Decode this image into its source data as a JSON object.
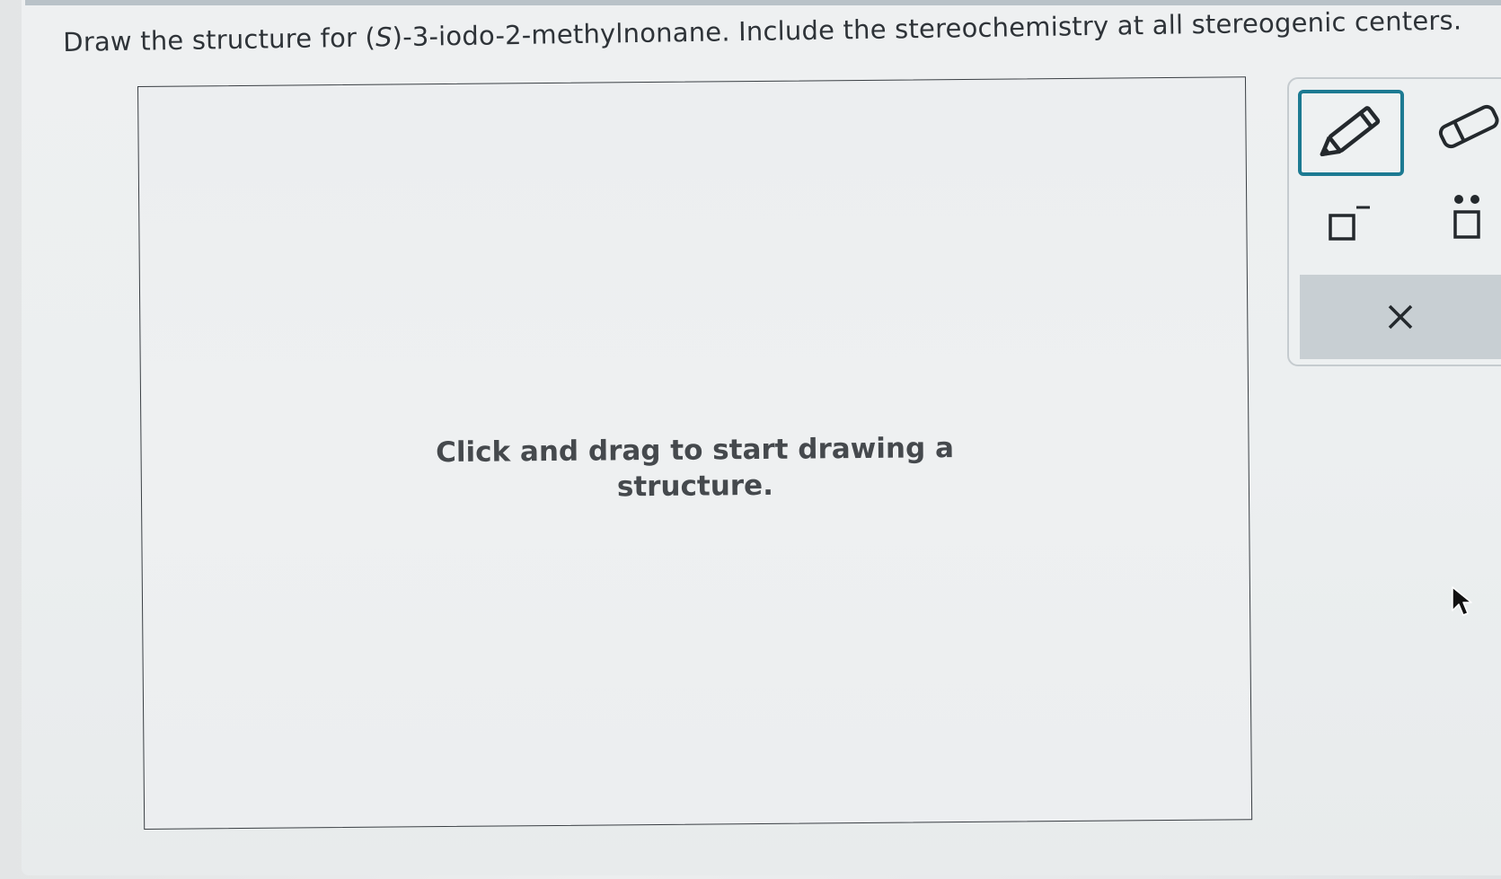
{
  "question": {
    "prefix": "Draw the structure for (",
    "stereo_label": "S",
    "suffix": ")-3-iodo-2-methylnonane. Include the stereochemistry at all stereogenic centers."
  },
  "canvas": {
    "hint_line1": "Click and drag to start drawing a",
    "hint_line2": "structure."
  },
  "toolbar": {
    "tools": [
      {
        "name": "pencil",
        "icon": "pencil-icon",
        "selected": true
      },
      {
        "name": "eraser",
        "icon": "eraser-icon",
        "selected": false
      },
      {
        "name": "charge",
        "icon": "negative-charge-icon",
        "selected": false
      },
      {
        "name": "lone-pair",
        "icon": "lone-pair-icon",
        "selected": false
      },
      {
        "name": "clear",
        "icon": "close-icon",
        "selected": false
      }
    ]
  },
  "colors": {
    "accent": "#1c7a92",
    "text": "#2e3338",
    "clear_button_bg": "#c8cfd3"
  }
}
